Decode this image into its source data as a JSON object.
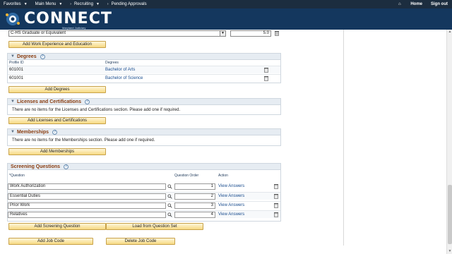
{
  "topnav": {
    "favorites": "Favorites",
    "main_menu": "Main Menu",
    "crumb1": "Recruiting",
    "crumb2": "Pending Approvals",
    "home": "Home",
    "signout": "Sign out"
  },
  "brand": {
    "name": "CONNECT",
    "sub": "Maryland Judiciary"
  },
  "education": {
    "select_value": "C-HS Graduate or Equivalent",
    "value": "5.0",
    "add_button": "Add Work Experience and Education"
  },
  "degrees": {
    "title": "Degrees",
    "columns": [
      "Profile ID",
      "Degrees"
    ],
    "rows": [
      {
        "profile_id": "601001",
        "degree": "Bachelor of Arts"
      },
      {
        "profile_id": "601001",
        "degree": "Bachelor of Science"
      }
    ],
    "add_button": "Add Degrees"
  },
  "licenses": {
    "title": "Licenses and Certifications",
    "message": "There are no items for the Licenses and Certifications section.  Please add one if required.",
    "add_button": "Add Licenses and Certifications"
  },
  "memberships": {
    "title": "Memberships",
    "message": "There are no items for the Memberships section.  Please add one if required.",
    "add_button": "Add Memberships"
  },
  "screening": {
    "title": "Screening Questions",
    "columns": [
      "*Question",
      "Question Order",
      "Action"
    ],
    "rows": [
      {
        "question": "Work Authorization",
        "order": "1",
        "action": "View Answers"
      },
      {
        "question": "Essential Duties",
        "order": "2",
        "action": "View Answers"
      },
      {
        "question": "Prior Work",
        "order": "3",
        "action": "View Answers"
      },
      {
        "question": "Relatives",
        "order": "4",
        "action": "View Answers"
      }
    ],
    "add_button": "Add Screening Question",
    "load_button": "Load from Question Set"
  },
  "footer_buttons": {
    "add_job_code": "Add Job Code",
    "delete_job_code": "Delete Job Code"
  },
  "colors": {
    "nav_bg": "#1c2d3f",
    "banner_bg": "#14375e",
    "section_title": "#8a3d10",
    "link": "#1a4d8f",
    "button_fill": "#f6d981"
  }
}
